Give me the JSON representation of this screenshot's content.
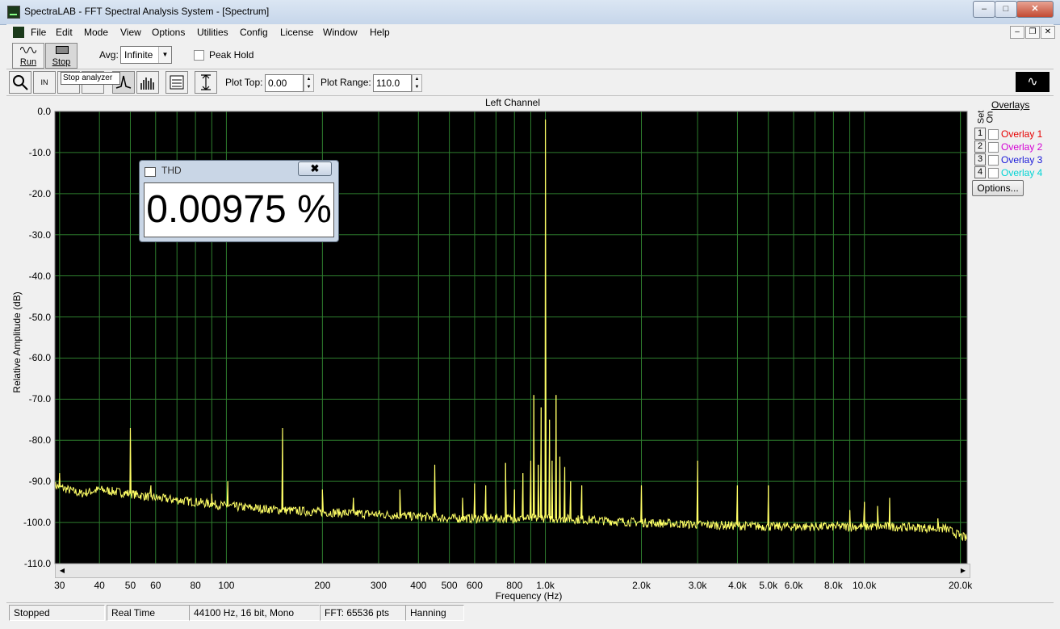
{
  "window": {
    "title": "SpectraLAB - FFT Spectral Analysis System - [Spectrum]",
    "minimize": "‒",
    "maximize": "□",
    "close": "✕"
  },
  "menu": [
    "File",
    "Edit",
    "Mode",
    "View",
    "Options",
    "Utilities",
    "Config",
    "License",
    "Window",
    "Help"
  ],
  "mdi_buttons": [
    "‒",
    "❐",
    "✕"
  ],
  "toolbar": {
    "run_label": "Run",
    "stop_label": "Stop",
    "avg_label": "Avg:",
    "avg_value": "Infinite",
    "peak_hold_label": "Peak Hold",
    "peak_hold_checked": false,
    "tooltip": "Stop analyzer",
    "zoom_icon": "magnifier-icon",
    "plot_top_label": "Plot Top:",
    "plot_top_value": "0.00",
    "plot_range_label": "Plot Range:",
    "plot_range_value": "110.0"
  },
  "overlays": {
    "title": "Overlays",
    "set_header": "Set",
    "on_header": "On",
    "items": [
      {
        "num": "1",
        "label": "Overlay 1",
        "color": "#e60000"
      },
      {
        "num": "2",
        "label": "Overlay 2",
        "color": "#d400d4"
      },
      {
        "num": "3",
        "label": "Overlay 3",
        "color": "#1a1ad9"
      },
      {
        "num": "4",
        "label": "Overlay 4",
        "color": "#00d4d4"
      }
    ],
    "options_label": "Options..."
  },
  "thd": {
    "title": "THD",
    "close": "✖",
    "value": "0.00975 %"
  },
  "status": {
    "state": "Stopped",
    "mode": "Real Time",
    "format": "44100 Hz, 16 bit, Mono",
    "fft": "FFT: 65536 pts",
    "window": "Hanning"
  },
  "chart_data": {
    "type": "line",
    "title": "Left Channel",
    "xlabel": "Frequency (Hz)",
    "ylabel": "Relative Amplitude (dB)",
    "xscale": "log",
    "xlim": [
      29,
      21000
    ],
    "ylim": [
      -110,
      0
    ],
    "grid": true,
    "line_color": "#ffff66",
    "background": "#000000",
    "grid_color": "#2e7d2e",
    "y_ticks": [
      0,
      -10,
      -20,
      -30,
      -40,
      -50,
      -60,
      -70,
      -80,
      -90,
      -100,
      -110
    ],
    "y_tick_labels": [
      "0.0",
      "-10.0",
      "-20.0",
      "-30.0",
      "-40.0",
      "-50.0",
      "-60.0",
      "-70.0",
      "-80.0",
      "-90.0",
      "-100.0",
      "-110.0"
    ],
    "x_ticks": [
      30,
      40,
      50,
      60,
      80,
      100,
      200,
      300,
      400,
      500,
      600,
      800,
      1000,
      2000,
      3000,
      4000,
      5000,
      6000,
      8000,
      10000,
      20000
    ],
    "x_tick_labels": [
      "30",
      "40",
      "50",
      "60",
      "80",
      "100",
      "200",
      "300",
      "400",
      "500",
      "600",
      "800",
      "1.0k",
      "2.0k",
      "3.0k",
      "4.0k",
      "5.0k",
      "6.0k",
      "8.0k",
      "10.0k",
      "20.0k"
    ],
    "noise_floor": [
      [
        29,
        -91
      ],
      [
        35,
        -93
      ],
      [
        40,
        -92
      ],
      [
        50,
        -93
      ],
      [
        60,
        -94
      ],
      [
        80,
        -95
      ],
      [
        100,
        -96
      ],
      [
        150,
        -97
      ],
      [
        200,
        -97.5
      ],
      [
        300,
        -98
      ],
      [
        500,
        -99
      ],
      [
        800,
        -99
      ],
      [
        1100,
        -99
      ],
      [
        2000,
        -100
      ],
      [
        3000,
        -100.5
      ],
      [
        5000,
        -101
      ],
      [
        8000,
        -101
      ],
      [
        12000,
        -101
      ],
      [
        18000,
        -101.5
      ],
      [
        21000,
        -104
      ]
    ],
    "peaks": [
      {
        "f": 30,
        "db": -88
      },
      {
        "f": 50,
        "db": -77
      },
      {
        "f": 58,
        "db": -91
      },
      {
        "f": 90,
        "db": -93
      },
      {
        "f": 101,
        "db": -90
      },
      {
        "f": 150,
        "db": -77
      },
      {
        "f": 200,
        "db": -92
      },
      {
        "f": 250,
        "db": -94
      },
      {
        "f": 350,
        "db": -92
      },
      {
        "f": 450,
        "db": -86
      },
      {
        "f": 550,
        "db": -94
      },
      {
        "f": 600,
        "db": -90.5
      },
      {
        "f": 650,
        "db": -91
      },
      {
        "f": 750,
        "db": -85.5
      },
      {
        "f": 800,
        "db": -92
      },
      {
        "f": 850,
        "db": -88
      },
      {
        "f": 900,
        "db": -85
      },
      {
        "f": 920,
        "db": -69
      },
      {
        "f": 950,
        "db": -86
      },
      {
        "f": 970,
        "db": -72
      },
      {
        "f": 1000,
        "db": -2
      },
      {
        "f": 1030,
        "db": -75
      },
      {
        "f": 1050,
        "db": -85
      },
      {
        "f": 1080,
        "db": -69
      },
      {
        "f": 1110,
        "db": -84
      },
      {
        "f": 1150,
        "db": -86.5
      },
      {
        "f": 1200,
        "db": -90
      },
      {
        "f": 1300,
        "db": -91
      },
      {
        "f": 2000,
        "db": -91
      },
      {
        "f": 3000,
        "db": -85
      },
      {
        "f": 4000,
        "db": -91
      },
      {
        "f": 5000,
        "db": -91
      },
      {
        "f": 9000,
        "db": -97
      },
      {
        "f": 10000,
        "db": -95
      },
      {
        "f": 11000,
        "db": -96
      },
      {
        "f": 12000,
        "db": -94
      },
      {
        "f": 17000,
        "db": -99
      }
    ]
  }
}
